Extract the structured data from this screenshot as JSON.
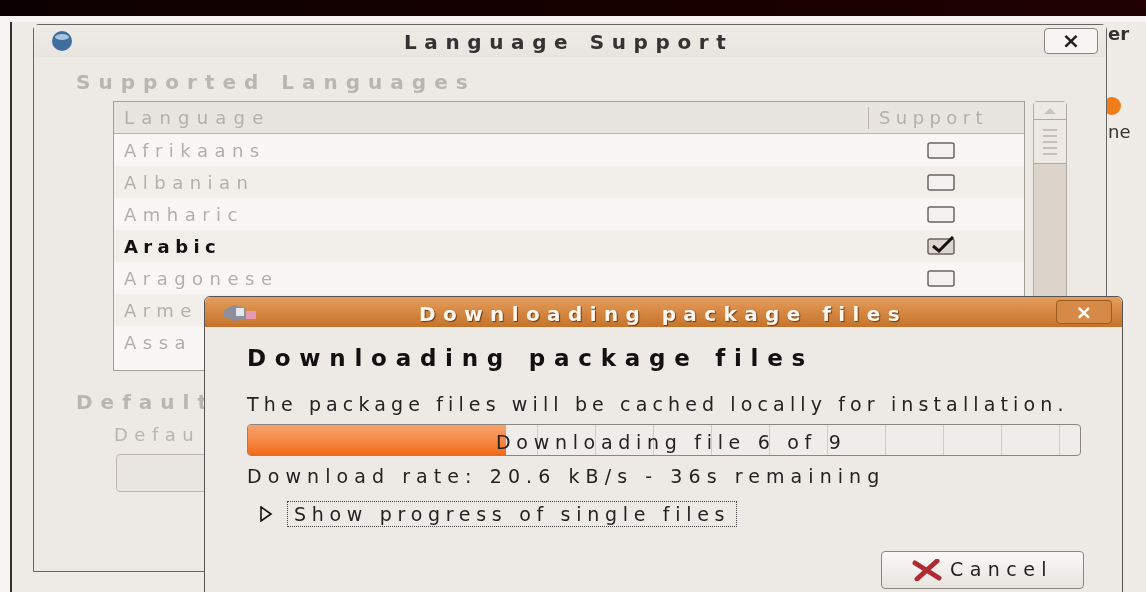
{
  "background_window": {
    "title_fragment": "er",
    "label_fragment": "ne"
  },
  "language_window": {
    "title": "Language Support",
    "close": "×",
    "section_title": "Supported Languages",
    "table": {
      "columns": [
        "Language",
        "Support"
      ],
      "rows": [
        {
          "language": "Afrikaans",
          "checked": false
        },
        {
          "language": "Albanian",
          "checked": false
        },
        {
          "language": "Amharic",
          "checked": false
        },
        {
          "language": "Arabic",
          "checked": true
        },
        {
          "language": "Aragonese",
          "checked": false
        },
        {
          "language": "Arme"
        },
        {
          "language": "Assa"
        }
      ]
    },
    "default_section_title": "Default",
    "default_label": "Defau"
  },
  "download_dialog": {
    "title": "Downloading package files",
    "close": "×",
    "heading": "Downloading package files",
    "description": "The package files will be cached locally for installation.",
    "progress": {
      "level": 0.31,
      "text": "Downloading file 6 of 9"
    },
    "rate": "Download rate: 20.6 kB/s - 36s remaining",
    "expander": {
      "expanded": false,
      "label": "Show progress of single files"
    },
    "cancel": "Cancel"
  }
}
